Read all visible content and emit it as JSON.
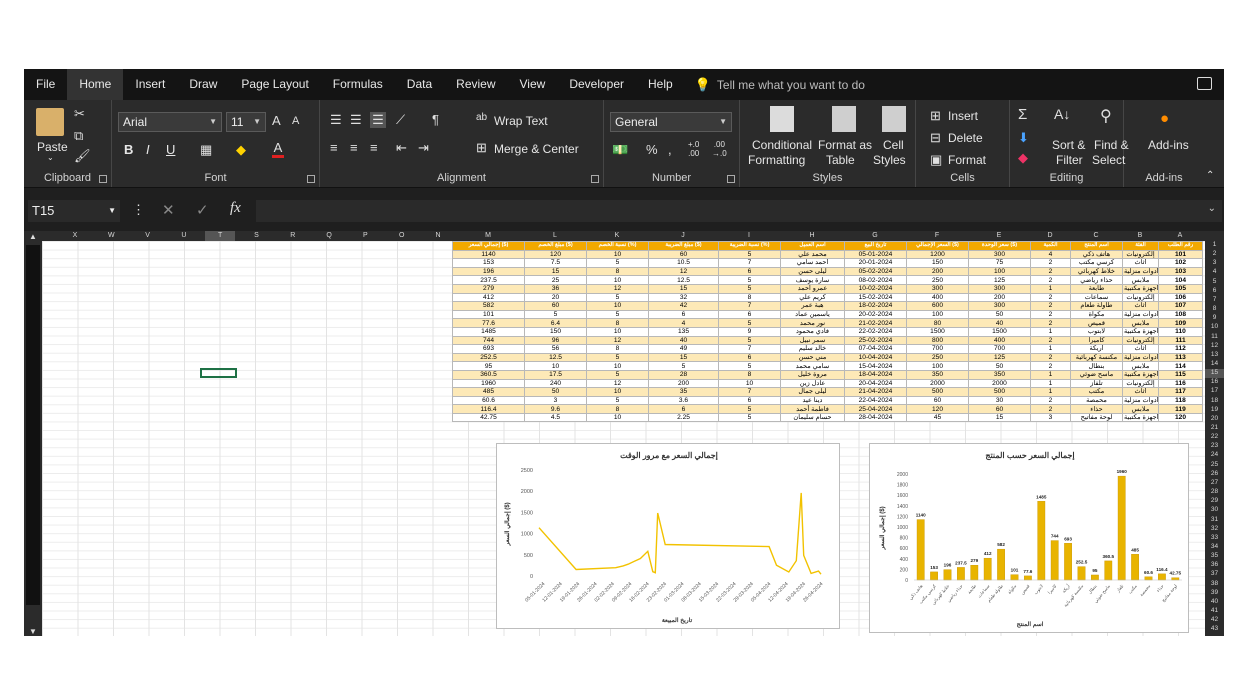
{
  "menu": {
    "tabs": [
      "File",
      "Home",
      "Insert",
      "Draw",
      "Page Layout",
      "Formulas",
      "Data",
      "Review",
      "View",
      "Developer",
      "Help"
    ],
    "active": "Home",
    "tell_me": "Tell me what you want to do"
  },
  "ribbon": {
    "clipboard": {
      "label": "Clipboard",
      "paste": "Paste"
    },
    "font": {
      "label": "Font",
      "name": "Arial",
      "size": "11",
      "bold": "B",
      "italic": "I",
      "underline": "U"
    },
    "alignment": {
      "label": "Alignment",
      "wrap": "Wrap Text",
      "merge": "Merge & Center"
    },
    "number": {
      "label": "Number",
      "format": "General"
    },
    "styles": {
      "label": "Styles",
      "conditional": "Conditional",
      "conditional2": "Formatting",
      "format_as": "Format as",
      "format_as2": "Table",
      "cell": "Cell",
      "cell2": "Styles"
    },
    "cells": {
      "label": "Cells",
      "insert": "Insert",
      "delete": "Delete",
      "format": "Format"
    },
    "editing": {
      "label": "Editing",
      "sort": "Sort &",
      "sort2": "Filter",
      "find": "Find &",
      "find2": "Select"
    },
    "addins": {
      "label": "Add-ins",
      "addins": "Add-ins"
    }
  },
  "formula_bar": {
    "name_box": "T15",
    "fx": "fx",
    "value": ""
  },
  "columns_left": [
    "X",
    "W",
    "V",
    "U",
    "T",
    "S",
    "R",
    "Q",
    "P",
    "O",
    "N"
  ],
  "columns_table": [
    "M",
    "L",
    "K",
    "J",
    "I",
    "H",
    "G",
    "F",
    "E",
    "D",
    "C",
    "B",
    "A"
  ],
  "rows": [
    "1",
    "2",
    "3",
    "4",
    "5",
    "6",
    "7",
    "8",
    "9",
    "10",
    "11",
    "12",
    "13",
    "14",
    "15",
    "16",
    "17",
    "18",
    "19",
    "20",
    "21",
    "22",
    "23",
    "24",
    "25",
    "26",
    "27",
    "28",
    "29",
    "30",
    "31",
    "32",
    "33",
    "34",
    "35",
    "36",
    "37",
    "38",
    "39",
    "40",
    "41",
    "42",
    "43"
  ],
  "table": {
    "headers": [
      "إجمالي السعر ($)",
      "مبلغ الخصم ($)",
      "نسبة الخصم (%)",
      "مبلغ الضريبة ($)",
      "نسبة الضريبة (%)",
      "اسم العميل",
      "تاريخ البيع",
      "السعر الإجمالي ($)",
      "سعر الوحدة ($)",
      "الكمية",
      "اسم المنتج",
      "الفئة",
      "رقم الطلب"
    ],
    "rows": [
      [
        "1140",
        "120",
        "10",
        "60",
        "5",
        "محمد علي",
        "05-01-2024",
        "1200",
        "300",
        "4",
        "هاتف ذكي",
        "إلكترونيات",
        "101"
      ],
      [
        "153",
        "7.5",
        "5",
        "10.5",
        "7",
        "أحمد سامي",
        "20-01-2024",
        "150",
        "75",
        "2",
        "كرسي مكتب",
        "أثاث",
        "102"
      ],
      [
        "196",
        "15",
        "8",
        "12",
        "6",
        "ليلى حسن",
        "05-02-2024",
        "200",
        "100",
        "2",
        "خلاط كهربائي",
        "أدوات منزلية",
        "103"
      ],
      [
        "237.5",
        "25",
        "10",
        "12.5",
        "5",
        "سارة يوسف",
        "08-02-2024",
        "250",
        "125",
        "2",
        "حذاء رياضي",
        "ملابس",
        "104"
      ],
      [
        "279",
        "36",
        "12",
        "15",
        "5",
        "عمرو أحمد",
        "10-02-2024",
        "300",
        "300",
        "1",
        "طابعة",
        "أجهزة مكتبية",
        "105"
      ],
      [
        "412",
        "20",
        "5",
        "32",
        "8",
        "كريم علي",
        "15-02-2024",
        "400",
        "200",
        "2",
        "سماعات",
        "إلكترونيات",
        "106"
      ],
      [
        "582",
        "60",
        "10",
        "42",
        "7",
        "هبة عمر",
        "18-02-2024",
        "600",
        "300",
        "2",
        "طاولة طعام",
        "أثاث",
        "107"
      ],
      [
        "101",
        "5",
        "5",
        "6",
        "6",
        "ياسمين عماد",
        "20-02-2024",
        "100",
        "50",
        "2",
        "مكواة",
        "أدوات منزلية",
        "108"
      ],
      [
        "77.6",
        "6.4",
        "8",
        "4",
        "5",
        "نور محمد",
        "21-02-2024",
        "80",
        "40",
        "2",
        "قميص",
        "ملابس",
        "109"
      ],
      [
        "1485",
        "150",
        "10",
        "135",
        "9",
        "فادي محمود",
        "22-02-2024",
        "1500",
        "1500",
        "1",
        "لابتوب",
        "أجهزة مكتبية",
        "110"
      ],
      [
        "744",
        "96",
        "12",
        "40",
        "5",
        "سمر نبيل",
        "25-02-2024",
        "800",
        "400",
        "2",
        "كاميرا",
        "إلكترونيات",
        "111"
      ],
      [
        "693",
        "56",
        "8",
        "49",
        "7",
        "خالد سليم",
        "07-04-2024",
        "700",
        "700",
        "1",
        "أريكة",
        "أثاث",
        "112"
      ],
      [
        "252.5",
        "12.5",
        "5",
        "15",
        "6",
        "مني حسن",
        "10-04-2024",
        "250",
        "125",
        "2",
        "مكنسة كهربائية",
        "أدوات منزلية",
        "113"
      ],
      [
        "95",
        "10",
        "10",
        "5",
        "5",
        "سامي محمد",
        "15-04-2024",
        "100",
        "50",
        "2",
        "بنطال",
        "ملابس",
        "114"
      ],
      [
        "360.5",
        "17.5",
        "5",
        "28",
        "8",
        "مروة خليل",
        "18-04-2024",
        "350",
        "350",
        "1",
        "ماسح ضوئي",
        "أجهزة مكتبية",
        "115"
      ],
      [
        "1960",
        "240",
        "12",
        "200",
        "10",
        "عادل زين",
        "20-04-2024",
        "2000",
        "2000",
        "1",
        "تلفاز",
        "إلكترونيات",
        "116"
      ],
      [
        "485",
        "50",
        "10",
        "35",
        "7",
        "ليلى جمال",
        "21-04-2024",
        "500",
        "500",
        "1",
        "مكتب",
        "أثاث",
        "117"
      ],
      [
        "60.6",
        "3",
        "5",
        "3.6",
        "6",
        "دينا عيد",
        "22-04-2024",
        "60",
        "30",
        "2",
        "محمصة",
        "أدوات منزلية",
        "118"
      ],
      [
        "116.4",
        "9.6",
        "8",
        "6",
        "5",
        "فاطمة أحمد",
        "25-04-2024",
        "120",
        "60",
        "2",
        "حذاء",
        "ملابس",
        "119"
      ],
      [
        "42.75",
        "4.5",
        "10",
        "2.25",
        "5",
        "حسام سليمان",
        "28-04-2024",
        "45",
        "15",
        "3",
        "لوحة مفاتيح",
        "أجهزة مكتبية",
        "120"
      ]
    ]
  },
  "chart_data": [
    {
      "type": "line",
      "title": "إجمالي السعر مع مرور الوقت",
      "xlabel": "تاريخ المبيعة",
      "ylabel": "إجمالي السعر ($)",
      "ylim": [
        0,
        2500
      ],
      "yticks": [
        "0",
        "500",
        "1000",
        "1500",
        "2000",
        "2500"
      ],
      "xticks": [
        "05-01-2024",
        "12-01-2024",
        "19-01-2024",
        "26-01-2024",
        "02-02-2024",
        "09-02-2024",
        "16-02-2024",
        "23-02-2024",
        "01-03-2024",
        "08-03-2024",
        "15-03-2024",
        "22-03-2024",
        "29-03-2024",
        "05-04-2024",
        "12-04-2024",
        "19-04-2024",
        "26-04-2024"
      ],
      "x": [
        0,
        15,
        31,
        34,
        36,
        41,
        44,
        46,
        47,
        48,
        51,
        93,
        96,
        101,
        104,
        106,
        107,
        110,
        113
      ],
      "values": [
        1140,
        153,
        196,
        237.5,
        279,
        412,
        582,
        101,
        77.6,
        1485,
        744,
        693,
        252.5,
        95,
        360.5,
        1960,
        485,
        60.6,
        116.4
      ],
      "x_last": 114,
      "value_last": 42.75,
      "color": "#f2c200"
    },
    {
      "type": "bar",
      "title": "إجمالي السعر حسب المنتج",
      "xlabel": "اسم المنتج",
      "ylabel": "إجمالي السعر ($)",
      "ylim": [
        0,
        2000
      ],
      "yticks": [
        "0",
        "200",
        "400",
        "600",
        "800",
        "1000",
        "1200",
        "1400",
        "1600",
        "1800",
        "2000"
      ],
      "categories": [
        "هاتف ذكي",
        "كرسي مكتب",
        "خلاط كهربائي",
        "حذاء رياضي",
        "طابعة",
        "سماعات",
        "طاولة طعام",
        "مكواة",
        "قميص",
        "لابتوب",
        "كاميرا",
        "أريكة",
        "مكنسة كهربائية",
        "بنطال",
        "ماسح ضوئي",
        "تلفاز",
        "مكتب",
        "محمصة",
        "حذاء",
        "لوحة مفاتيح"
      ],
      "values": [
        1140,
        153,
        196,
        237.5,
        279,
        412,
        582,
        101,
        77.6,
        1485,
        744,
        693,
        252.5,
        95,
        360.5,
        1960,
        485,
        60.6,
        116.4,
        42.75
      ],
      "labels": [
        "1140",
        "153",
        "196",
        "237.5",
        "279",
        "412",
        "582",
        "101",
        "77.6",
        "1485",
        "744",
        "693",
        "252.5",
        "95",
        "360.5",
        "1960",
        "485",
        "60.6",
        "116.4",
        "42.75"
      ],
      "color": "#e8b400"
    }
  ]
}
